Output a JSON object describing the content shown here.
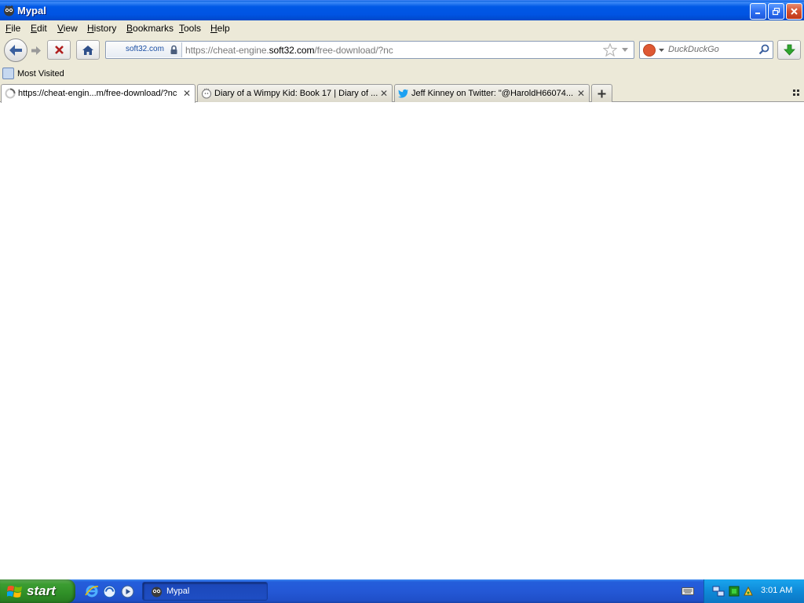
{
  "window": {
    "title": "Mypal",
    "accent": "#0054e3"
  },
  "menu": {
    "items": [
      {
        "label": "File",
        "mnemonic": "F",
        "rest": "ile"
      },
      {
        "label": "Edit",
        "mnemonic": "E",
        "rest": "dit"
      },
      {
        "label": "View",
        "mnemonic": "V",
        "rest": "iew"
      },
      {
        "label": "History",
        "mnemonic": "H",
        "rest": "istory"
      },
      {
        "label": "Bookmarks",
        "mnemonic": "B",
        "rest": "ookmarks"
      },
      {
        "label": "Tools",
        "mnemonic": "T",
        "rest": "ools"
      },
      {
        "label": "Help",
        "mnemonic": "H",
        "rest": "elp"
      }
    ]
  },
  "nav": {
    "identity_host": "soft32.com",
    "url_prefix": "https://cheat-engine.",
    "url_domain": "soft32.com",
    "url_suffix": "/free-download/?nc",
    "search_placeholder": "DuckDuckGo"
  },
  "bookmarks": {
    "items": [
      {
        "label": "Most Visited"
      }
    ]
  },
  "tabs": [
    {
      "label": "https://cheat-engin...m/free-download/?nc",
      "active": true,
      "favicon": "loading-spinner-icon"
    },
    {
      "label": "Diary of a Wimpy Kid: Book 17 | Diary of ...",
      "active": false,
      "favicon": "site-icon"
    },
    {
      "label": "Jeff Kinney on Twitter: \"@HaroldH66074...",
      "active": false,
      "favicon": "twitter-bird-icon"
    }
  ],
  "taskbar": {
    "start_label": "start",
    "task_label": "Mypal",
    "clock": "3:01 AM"
  }
}
